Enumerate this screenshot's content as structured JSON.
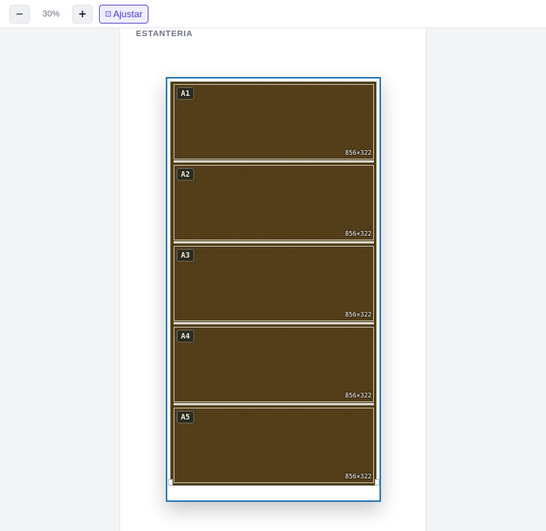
{
  "toolbar": {
    "zoom_out_label": "−",
    "zoom_level": "30%",
    "zoom_in_label": "+",
    "fit_icon": "⊡",
    "fit_label": "Ajustar"
  },
  "panel": {
    "title": "ESTANTERIA"
  },
  "shelves": [
    {
      "label": "A1",
      "size": "856×322"
    },
    {
      "label": "A2",
      "size": "856×322"
    },
    {
      "label": "A3",
      "size": "856×322"
    },
    {
      "label": "A4",
      "size": "856×322"
    },
    {
      "label": "A5",
      "size": "856×322"
    }
  ],
  "colors": {
    "accent": "#4338ca",
    "selection": "#2a7ab8",
    "wood": "#56401a"
  }
}
